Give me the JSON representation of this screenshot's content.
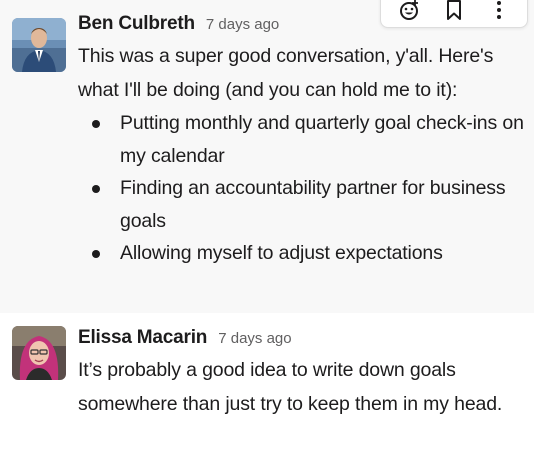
{
  "messages": [
    {
      "author": "Ben Culbreth",
      "timestamp": "7 days ago",
      "text": "This was a super good conversation, y'all. Here's what I'll be doing (and you can hold me to it):",
      "bullets": [
        "Putting monthly and quarterly goal check-ins on my calendar",
        "Finding an accountability partner for business goals",
        "Allowing myself to adjust expectations"
      ],
      "avatar_icon": "user-photo-man"
    },
    {
      "author": "Elissa Macarin",
      "timestamp": "7 days ago",
      "text": "It’s probably a good idea to write down goals somewhere than just try to keep them in my head.",
      "avatar_icon": "user-photo-woman"
    }
  ],
  "hover_actions": [
    {
      "icon": "add-reaction-icon"
    },
    {
      "icon": "bookmark-icon"
    },
    {
      "icon": "more-actions-icon"
    }
  ],
  "colors": {
    "hover_bg": "#f8f8f8",
    "text": "#1d1c1d",
    "timestamp": "#616061"
  }
}
